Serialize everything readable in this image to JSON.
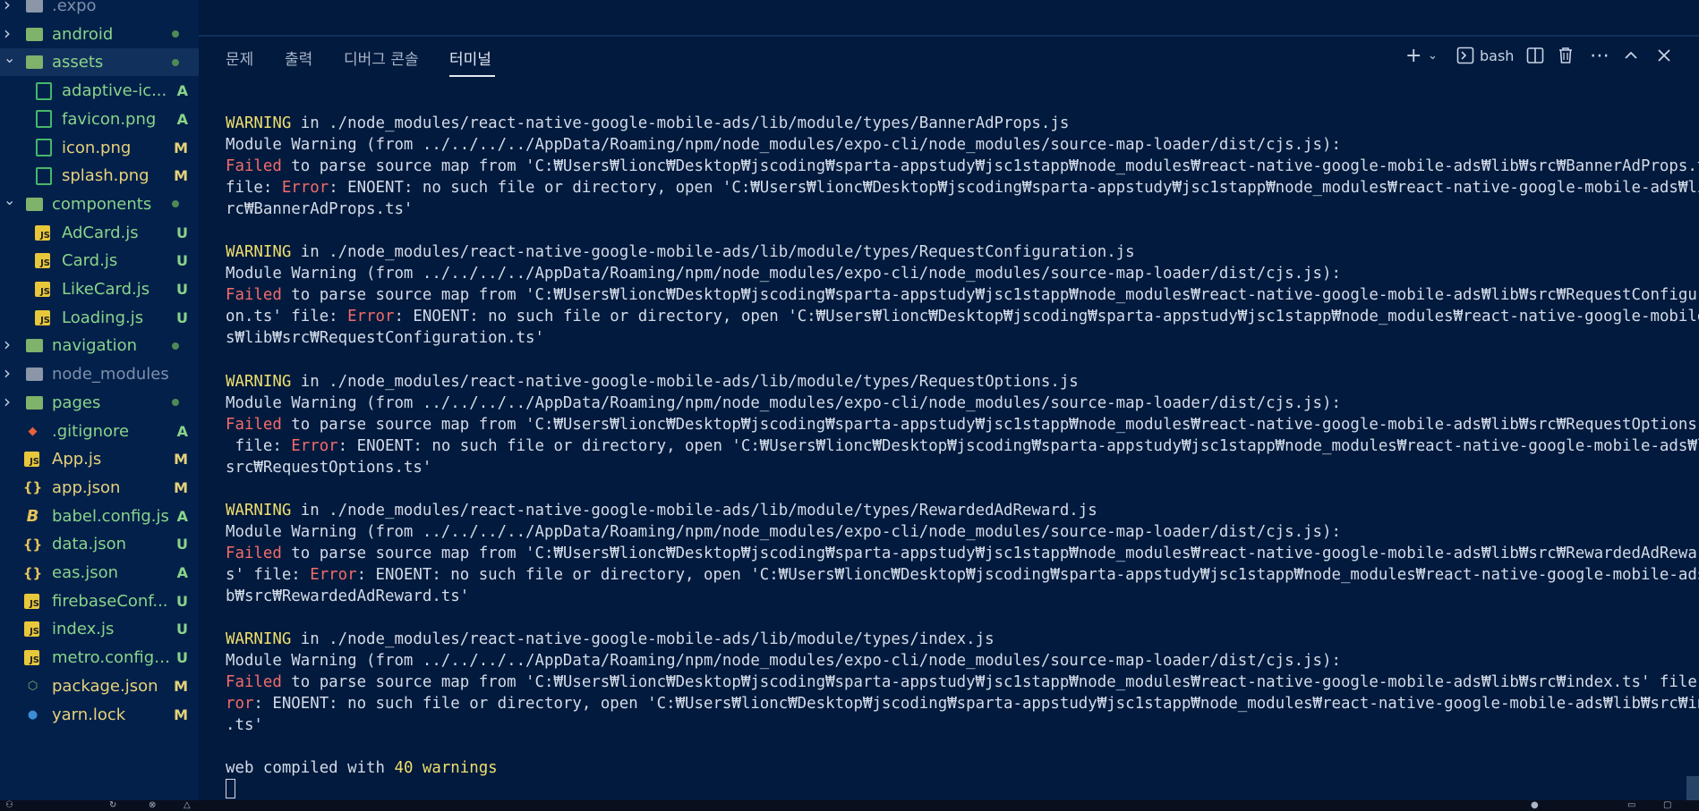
{
  "explorer": {
    "items": [
      {
        "name": ".expo",
        "kind": "folder-closed",
        "color": "#7d8fab",
        "status": ""
      },
      {
        "name": "android",
        "kind": "folder-closed",
        "color": "#8ad389",
        "status": "dot"
      },
      {
        "name": "assets",
        "kind": "folder-open",
        "color": "#8ad389",
        "status": "dot",
        "selected": true
      },
      {
        "name": "adaptive-ic...",
        "kind": "image",
        "color": "#8ad389",
        "status": "A"
      },
      {
        "name": "favicon.png",
        "kind": "image",
        "color": "#8ad389",
        "status": "A"
      },
      {
        "name": "icon.png",
        "kind": "image",
        "color": "#e6d17a",
        "status": "M"
      },
      {
        "name": "splash.png",
        "kind": "image",
        "color": "#e6d17a",
        "status": "M"
      },
      {
        "name": "components",
        "kind": "folder-open",
        "color": "#8ad389",
        "status": "dot"
      },
      {
        "name": "AdCard.js",
        "kind": "js",
        "color": "#8ad389",
        "status": "U"
      },
      {
        "name": "Card.js",
        "kind": "js",
        "color": "#8ad389",
        "status": "U"
      },
      {
        "name": "LikeCard.js",
        "kind": "js",
        "color": "#8ad389",
        "status": "U"
      },
      {
        "name": "Loading.js",
        "kind": "js",
        "color": "#8ad389",
        "status": "U"
      },
      {
        "name": "navigation",
        "kind": "folder-closed",
        "color": "#8ad389",
        "status": "dot"
      },
      {
        "name": "node_modules",
        "kind": "folder-closed",
        "color": "#7d8fab",
        "status": ""
      },
      {
        "name": "pages",
        "kind": "folder-closed",
        "color": "#8ad389",
        "status": "dot"
      },
      {
        "name": ".gitignore",
        "kind": "git",
        "color": "#8ad389",
        "status": "A"
      },
      {
        "name": "App.js",
        "kind": "js",
        "color": "#e6d17a",
        "status": "M"
      },
      {
        "name": "app.json",
        "kind": "json",
        "color": "#e6d17a",
        "status": "M"
      },
      {
        "name": "babel.config.js",
        "kind": "babel",
        "color": "#8ad389",
        "status": "A"
      },
      {
        "name": "data.json",
        "kind": "json",
        "color": "#8ad389",
        "status": "U"
      },
      {
        "name": "eas.json",
        "kind": "json",
        "color": "#8ad389",
        "status": "A"
      },
      {
        "name": "firebaseConf...",
        "kind": "js",
        "color": "#8ad389",
        "status": "U"
      },
      {
        "name": "index.js",
        "kind": "js",
        "color": "#8ad389",
        "status": "U"
      },
      {
        "name": "metro.config.js",
        "kind": "js",
        "color": "#8ad389",
        "status": "U"
      },
      {
        "name": "package.json",
        "kind": "node",
        "color": "#e6d17a",
        "status": "M"
      },
      {
        "name": "yarn.lock",
        "kind": "yarn",
        "color": "#e6d17a",
        "status": "M"
      }
    ]
  },
  "panel": {
    "tabs": [
      "문제",
      "출력",
      "디버그 콘솔",
      "터미널"
    ],
    "active_tab": "터미널",
    "shell_label": "bash"
  },
  "terminal": {
    "lines": [
      [
        {
          "t": "WARNING",
          "c": "warn"
        },
        {
          "t": " in ./node_modules/react-native-google-mobile-ads/lib/module/types/BannerAdProps.js"
        }
      ],
      [
        {
          "t": "Module Warning (from ../../../../AppData/Roaming/npm/node_modules/expo-cli/node_modules/source-map-loader/dist/cjs.js):"
        }
      ],
      [
        {
          "t": "Failed",
          "c": "err"
        },
        {
          "t": " to parse source map from 'C:₩Users₩lionc₩Desktop₩jscoding₩sparta-appstudy₩jsc1stapp₩node_modules₩react-native-google-mobile-ads₩lib₩src₩BannerAdProps.ts'"
        }
      ],
      [
        {
          "t": "file: "
        },
        {
          "t": "Error",
          "c": "err"
        },
        {
          "t": ": ENOENT: no such file or directory, open 'C:₩Users₩lionc₩Desktop₩jscoding₩sparta-appstudy₩jsc1stapp₩node_modules₩react-native-google-mobile-ads₩lib₩s"
        }
      ],
      [
        {
          "t": "rc₩BannerAdProps.ts'"
        }
      ],
      [
        {
          "t": ""
        }
      ],
      [
        {
          "t": "WARNING",
          "c": "warn"
        },
        {
          "t": " in ./node_modules/react-native-google-mobile-ads/lib/module/types/RequestConfiguration.js"
        }
      ],
      [
        {
          "t": "Module Warning (from ../../../../AppData/Roaming/npm/node_modules/expo-cli/node_modules/source-map-loader/dist/cjs.js):"
        }
      ],
      [
        {
          "t": "Failed",
          "c": "err"
        },
        {
          "t": " to parse source map from 'C:₩Users₩lionc₩Desktop₩jscoding₩sparta-appstudy₩jsc1stapp₩node_modules₩react-native-google-mobile-ads₩lib₩src₩RequestConfigurati"
        }
      ],
      [
        {
          "t": "on.ts' file: "
        },
        {
          "t": "Error",
          "c": "err"
        },
        {
          "t": ": ENOENT: no such file or directory, open 'C:₩Users₩lionc₩Desktop₩jscoding₩sparta-appstudy₩jsc1stapp₩node_modules₩react-native-google-mobile-ad"
        }
      ],
      [
        {
          "t": "s₩lib₩src₩RequestConfiguration.ts'"
        }
      ],
      [
        {
          "t": ""
        }
      ],
      [
        {
          "t": "WARNING",
          "c": "warn"
        },
        {
          "t": " in ./node_modules/react-native-google-mobile-ads/lib/module/types/RequestOptions.js"
        }
      ],
      [
        {
          "t": "Module Warning (from ../../../../AppData/Roaming/npm/node_modules/expo-cli/node_modules/source-map-loader/dist/cjs.js):"
        }
      ],
      [
        {
          "t": "Failed",
          "c": "err"
        },
        {
          "t": " to parse source map from 'C:₩Users₩lionc₩Desktop₩jscoding₩sparta-appstudy₩jsc1stapp₩node_modules₩react-native-google-mobile-ads₩lib₩src₩RequestOptions.ts'"
        }
      ],
      [
        {
          "t": " file: "
        },
        {
          "t": "Error",
          "c": "err"
        },
        {
          "t": ": ENOENT: no such file or directory, open 'C:₩Users₩lionc₩Desktop₩jscoding₩sparta-appstudy₩jsc1stapp₩node_modules₩react-native-google-mobile-ads₩lib₩"
        }
      ],
      [
        {
          "t": "src₩RequestOptions.ts'"
        }
      ],
      [
        {
          "t": ""
        }
      ],
      [
        {
          "t": "WARNING",
          "c": "warn"
        },
        {
          "t": " in ./node_modules/react-native-google-mobile-ads/lib/module/types/RewardedAdReward.js"
        }
      ],
      [
        {
          "t": "Module Warning (from ../../../../AppData/Roaming/npm/node_modules/expo-cli/node_modules/source-map-loader/dist/cjs.js):"
        }
      ],
      [
        {
          "t": "Failed",
          "c": "err"
        },
        {
          "t": " to parse source map from 'C:₩Users₩lionc₩Desktop₩jscoding₩sparta-appstudy₩jsc1stapp₩node_modules₩react-native-google-mobile-ads₩lib₩src₩RewardedAdReward.t"
        }
      ],
      [
        {
          "t": "s' file: "
        },
        {
          "t": "Error",
          "c": "err"
        },
        {
          "t": ": ENOENT: no such file or directory, open 'C:₩Users₩lionc₩Desktop₩jscoding₩sparta-appstudy₩jsc1stapp₩node_modules₩react-native-google-mobile-ads₩li"
        }
      ],
      [
        {
          "t": "b₩src₩RewardedAdReward.ts'"
        }
      ],
      [
        {
          "t": ""
        }
      ],
      [
        {
          "t": "WARNING",
          "c": "warn"
        },
        {
          "t": " in ./node_modules/react-native-google-mobile-ads/lib/module/types/index.js"
        }
      ],
      [
        {
          "t": "Module Warning (from ../../../../AppData/Roaming/npm/node_modules/expo-cli/node_modules/source-map-loader/dist/cjs.js):"
        }
      ],
      [
        {
          "t": "Failed",
          "c": "err"
        },
        {
          "t": " to parse source map from 'C:₩Users₩lionc₩Desktop₩jscoding₩sparta-appstudy₩jsc1stapp₩node_modules₩react-native-google-mobile-ads₩lib₩src₩index.ts' file: "
        },
        {
          "t": "Er",
          "c": "err"
        }
      ],
      [
        {
          "t": "ror",
          "c": "err"
        },
        {
          "t": ": ENOENT: no such file or directory, open 'C:₩Users₩lionc₩Desktop₩jscoding₩sparta-appstudy₩jsc1stapp₩node_modules₩react-native-google-mobile-ads₩lib₩src₩index"
        }
      ],
      [
        {
          "t": ".ts'"
        }
      ],
      [
        {
          "t": ""
        }
      ],
      [
        {
          "t": "web compiled with "
        },
        {
          "t": "40 warnings",
          "c": "warn"
        }
      ]
    ]
  }
}
